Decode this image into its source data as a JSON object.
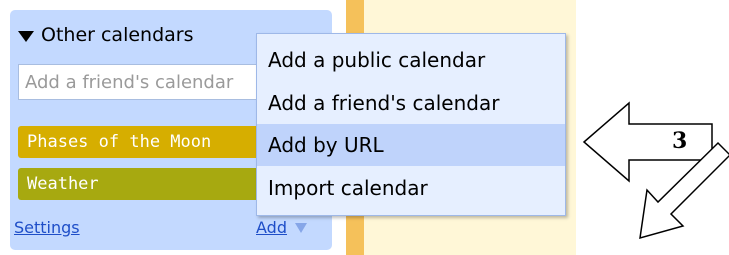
{
  "panel": {
    "header": "Other calendars",
    "friend_input_placeholder": "Add a friend's calendar",
    "calendars": [
      {
        "label": "Phases of the Moon",
        "color": "#d6ae00"
      },
      {
        "label": "Weather",
        "color": "#a7a910"
      }
    ],
    "settings_link": "Settings",
    "add_link": "Add"
  },
  "menu": {
    "items": [
      {
        "label": "Add a public calendar"
      },
      {
        "label": "Add a friend's calendar"
      },
      {
        "label": "Add by URL",
        "selected": true
      },
      {
        "label": "Import calendar"
      }
    ]
  },
  "annotation": {
    "step": "3"
  },
  "colors": {
    "panel_bg": "#c3d9ff",
    "menu_bg": "#e6efff",
    "menu_selected": "#bfd3fb",
    "link": "#1e4ec8"
  }
}
